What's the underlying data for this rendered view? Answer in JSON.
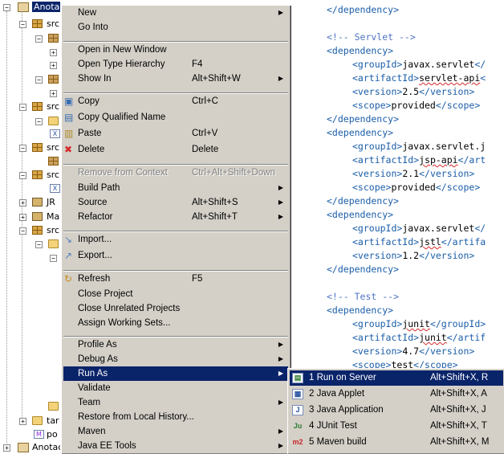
{
  "tree": {
    "root_label": "Anotac",
    "items": [
      {
        "label": "src",
        "icon": "source-folder-icon"
      },
      {
        "label": "src",
        "icon": "source-folder-icon"
      },
      {
        "label": "src",
        "icon": "source-folder-icon"
      },
      {
        "label": "src",
        "icon": "source-folder-icon"
      },
      {
        "label": "JR",
        "icon": "library-icon"
      },
      {
        "label": "Ma",
        "icon": "library-icon"
      },
      {
        "label": "src",
        "icon": "source-folder-icon"
      },
      {
        "label": "tar",
        "icon": "folder-icon"
      },
      {
        "label": "po",
        "icon": "pom-file-icon"
      },
      {
        "label": "Anotac",
        "icon": "project-icon"
      }
    ]
  },
  "menu": {
    "items": [
      {
        "label": "New",
        "accel": "",
        "submenu": true
      },
      {
        "label": "Go Into",
        "accel": ""
      },
      {
        "label": "Open in New Window",
        "accel": ""
      },
      {
        "label": "Open Type Hierarchy",
        "accel": "F4"
      },
      {
        "label": "Show In",
        "accel": "Alt+Shift+W",
        "submenu": true
      },
      {
        "label": "Copy",
        "accel": "Ctrl+C",
        "icon": "copy-icon"
      },
      {
        "label": "Copy Qualified Name",
        "accel": "",
        "icon": "copy-qualified-name-icon"
      },
      {
        "label": "Paste",
        "accel": "Ctrl+V",
        "icon": "paste-icon"
      },
      {
        "label": "Delete",
        "accel": "Delete",
        "icon": "delete-icon"
      },
      {
        "label": "Remove from Context",
        "accel": "Ctrl+Alt+Shift+Down",
        "disabled": true
      },
      {
        "label": "Build Path",
        "accel": "",
        "submenu": true
      },
      {
        "label": "Source",
        "accel": "Alt+Shift+S",
        "submenu": true
      },
      {
        "label": "Refactor",
        "accel": "Alt+Shift+T",
        "submenu": true
      },
      {
        "label": "Import...",
        "accel": "",
        "icon": "import-icon"
      },
      {
        "label": "Export...",
        "accel": "",
        "icon": "export-icon"
      },
      {
        "label": "Refresh",
        "accel": "F5",
        "icon": "refresh-icon"
      },
      {
        "label": "Close Project",
        "accel": ""
      },
      {
        "label": "Close Unrelated Projects",
        "accel": ""
      },
      {
        "label": "Assign Working Sets...",
        "accel": ""
      },
      {
        "label": "Profile As",
        "accel": "",
        "submenu": true
      },
      {
        "label": "Debug As",
        "accel": "",
        "submenu": true
      },
      {
        "label": "Run As",
        "accel": "",
        "submenu": true,
        "selected": true
      },
      {
        "label": "Validate",
        "accel": ""
      },
      {
        "label": "Team",
        "accel": "",
        "submenu": true
      },
      {
        "label": "Restore from Local History...",
        "accel": ""
      },
      {
        "label": "Maven",
        "accel": "",
        "submenu": true
      },
      {
        "label": "Java EE Tools",
        "accel": "",
        "submenu": true
      }
    ]
  },
  "submenu": {
    "items": [
      {
        "label": "1 Run on Server",
        "accel": "Alt+Shift+X, R",
        "icon": "server-icon",
        "glyph": "▤",
        "selected": true
      },
      {
        "label": "2 Java Applet",
        "accel": "Alt+Shift+X, A",
        "icon": "java-applet-icon",
        "glyph": "▦"
      },
      {
        "label": "3 Java Application",
        "accel": "Alt+Shift+X, J",
        "icon": "java-application-icon",
        "glyph": "J"
      },
      {
        "label": "4 JUnit Test",
        "accel": "Alt+Shift+X, T",
        "icon": "junit-icon",
        "glyph": "Ju"
      },
      {
        "label": "5 Maven build",
        "accel": "Alt+Shift+X, M",
        "icon": "maven-icon",
        "glyph": "m2"
      }
    ]
  },
  "editor": {
    "lines": [
      {
        "parts": [
          [
            "tag",
            "</dependency>"
          ]
        ]
      },
      {
        "parts": []
      },
      {
        "parts": [
          [
            "cmt",
            "<!-- Servlet -->"
          ]
        ]
      },
      {
        "parts": [
          [
            "tag",
            "<dependency>"
          ]
        ]
      },
      {
        "parts": [
          [
            "tag",
            "<groupId>"
          ],
          [
            "txt",
            "javax.servlet"
          ],
          [
            "tag",
            "</"
          ]
        ],
        "indent": true
      },
      {
        "parts": [
          [
            "tag",
            "<artifactId>"
          ],
          [
            "sq",
            "servlet-api"
          ],
          [
            "tag",
            "<"
          ]
        ],
        "indent": true
      },
      {
        "parts": [
          [
            "tag",
            "<version>"
          ],
          [
            "txt",
            "2.5"
          ],
          [
            "tag",
            "</version>"
          ]
        ],
        "indent": true
      },
      {
        "parts": [
          [
            "tag",
            "<scope>"
          ],
          [
            "txt",
            "provided"
          ],
          [
            "tag",
            "</scope>"
          ]
        ],
        "indent": true
      },
      {
        "parts": [
          [
            "tag",
            "</dependency>"
          ]
        ]
      },
      {
        "parts": [
          [
            "tag",
            "<dependency>"
          ]
        ]
      },
      {
        "parts": [
          [
            "tag",
            "<groupId>"
          ],
          [
            "txt",
            "javax.servlet.j"
          ]
        ],
        "indent": true
      },
      {
        "parts": [
          [
            "tag",
            "<artifactId>"
          ],
          [
            "sq",
            "jsp-api"
          ],
          [
            "tag",
            "</art"
          ]
        ],
        "indent": true
      },
      {
        "parts": [
          [
            "tag",
            "<version>"
          ],
          [
            "txt",
            "2.1"
          ],
          [
            "tag",
            "</version>"
          ]
        ],
        "indent": true
      },
      {
        "parts": [
          [
            "tag",
            "<scope>"
          ],
          [
            "txt",
            "provided"
          ],
          [
            "tag",
            "</scope>"
          ]
        ],
        "indent": true
      },
      {
        "parts": [
          [
            "tag",
            "</dependency>"
          ]
        ]
      },
      {
        "parts": [
          [
            "tag",
            "<dependency>"
          ]
        ]
      },
      {
        "parts": [
          [
            "tag",
            "<groupId>"
          ],
          [
            "txt",
            "javax.servlet"
          ],
          [
            "tag",
            "</"
          ]
        ],
        "indent": true
      },
      {
        "parts": [
          [
            "tag",
            "<artifactId>"
          ],
          [
            "sq",
            "jstl"
          ],
          [
            "tag",
            "</artifa"
          ]
        ],
        "indent": true
      },
      {
        "parts": [
          [
            "tag",
            "<version>"
          ],
          [
            "txt",
            "1.2"
          ],
          [
            "tag",
            "</version>"
          ]
        ],
        "indent": true
      },
      {
        "parts": [
          [
            "tag",
            "</dependency>"
          ]
        ]
      },
      {
        "parts": []
      },
      {
        "parts": [
          [
            "cmt",
            "<!-- Test -->"
          ]
        ]
      },
      {
        "parts": [
          [
            "tag",
            "<dependency>"
          ]
        ]
      },
      {
        "parts": [
          [
            "tag",
            "<groupId>"
          ],
          [
            "sq",
            "junit"
          ],
          [
            "tag",
            "</groupId>"
          ]
        ],
        "indent": true
      },
      {
        "parts": [
          [
            "tag",
            "<artifactId>"
          ],
          [
            "sq",
            "junit"
          ],
          [
            "tag",
            "</artif"
          ]
        ],
        "indent": true
      },
      {
        "parts": [
          [
            "tag",
            "<version>"
          ],
          [
            "txt",
            "4.7"
          ],
          [
            "tag",
            "</version>"
          ]
        ],
        "indent": true
      },
      {
        "parts": [
          [
            "tag",
            "<scope>"
          ],
          [
            "txt",
            "test"
          ],
          [
            "tag",
            "</scope>"
          ]
        ],
        "indent": true
      }
    ]
  }
}
